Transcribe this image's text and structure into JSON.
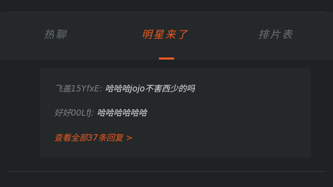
{
  "tabs": [
    {
      "label": "热聊",
      "active": false
    },
    {
      "label": "明星来了",
      "active": true
    },
    {
      "label": "排片表",
      "active": false
    }
  ],
  "comments": [
    {
      "author": "飞盖15YfxE:",
      "text": "哈哈哈jojo不害西少的吗"
    },
    {
      "author": "好好00LfJ:",
      "text": "哈哈哈哈哈哈"
    }
  ],
  "view_all_label": "查看全部37条回复",
  "colors": {
    "accent": "#f05a1f",
    "background": "#1e2224",
    "card": "#242829",
    "muted_text": "#7e8385",
    "text": "#e3e5e6"
  },
  "icons": {
    "view_all_arrow": "chevron-right-icon"
  }
}
